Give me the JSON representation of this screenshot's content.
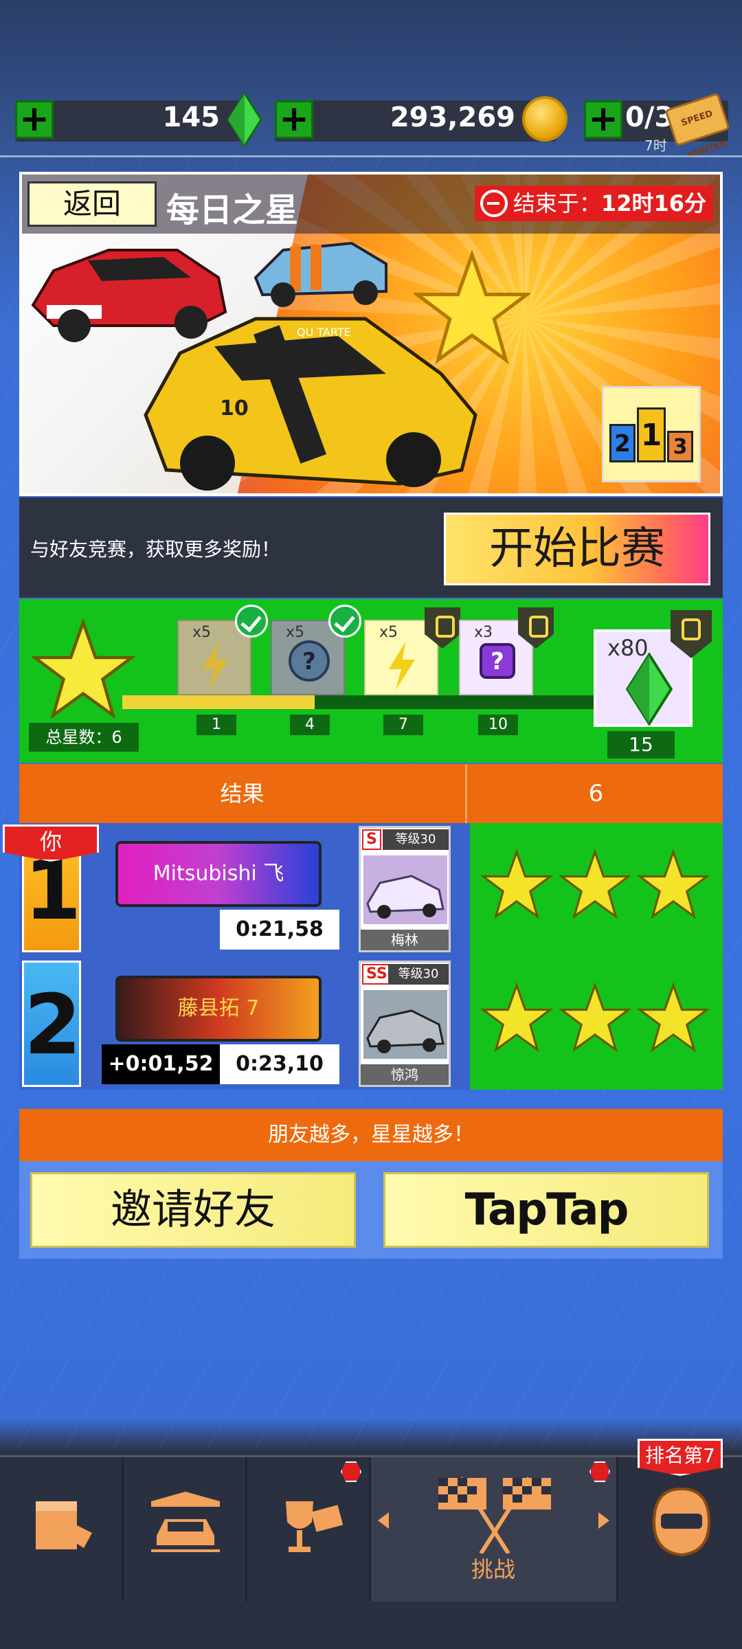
{
  "currencies": {
    "gems": "145",
    "coins": "293,269",
    "tickets": "0/3",
    "tickets_sub": "7时",
    "ticket_icon_text": "SPEED HUNTER"
  },
  "banner": {
    "back_label": "返回",
    "title": "每日之星",
    "end_label": "结束于：",
    "end_time": "12时16分",
    "car_plate_text": "QU TARTE",
    "car_number": "10",
    "podium": [
      "2",
      "1",
      "3"
    ]
  },
  "start": {
    "hint": "与好友竞赛，获取更多奖励！",
    "button": "开始比赛"
  },
  "progress": {
    "total_stars_label": "总星数：6",
    "total_stars": 6,
    "rewards": [
      {
        "count": "x5",
        "type": "lightning",
        "state": "claimed",
        "threshold": "1"
      },
      {
        "count": "x5",
        "type": "mystery",
        "state": "claimed",
        "threshold": "4"
      },
      {
        "count": "x5",
        "type": "lightning",
        "state": "locked",
        "threshold": "7"
      },
      {
        "count": "x3",
        "type": "mystery",
        "state": "locked",
        "threshold": "10"
      }
    ],
    "final_reward": {
      "count": "x80",
      "type": "gem",
      "state": "locked",
      "threshold": "15"
    },
    "progress_fraction": 0.4
  },
  "results": {
    "header_label": "结果",
    "header_value": "6",
    "you_tag": "你",
    "rows": [
      {
        "rank": "1",
        "player": "Mitsubishi 飞",
        "time": "0:21,58",
        "gap": "",
        "tier": "S",
        "level": "等级30",
        "car": "梅林",
        "stars": 3
      },
      {
        "rank": "2",
        "player": "藤县拓 7",
        "time": "0:23,10",
        "gap": "+0:01,52",
        "tier": "SS",
        "level": "等级30",
        "car": "惊鸿",
        "stars": 3
      }
    ]
  },
  "friends": {
    "header": "朋友越多，星星越多！",
    "invite_button": "邀请好友",
    "taptap_button": "TapTap"
  },
  "nav": {
    "items": [
      {
        "name": "garage-shop",
        "icon": "box-icon"
      },
      {
        "name": "cars",
        "icon": "car-icon"
      },
      {
        "name": "cups",
        "icon": "trophy-icon"
      },
      {
        "name": "challenge",
        "icon": "flags-icon",
        "label": "挑战"
      },
      {
        "name": "profile",
        "icon": "helmet-icon"
      }
    ],
    "rank_tag": "排名第7"
  },
  "colors": {
    "accent_orange": "#ee6a0e",
    "panel_green": "#14c21c",
    "bg_blue": "#3a72e0",
    "alert_red": "#e52222"
  }
}
